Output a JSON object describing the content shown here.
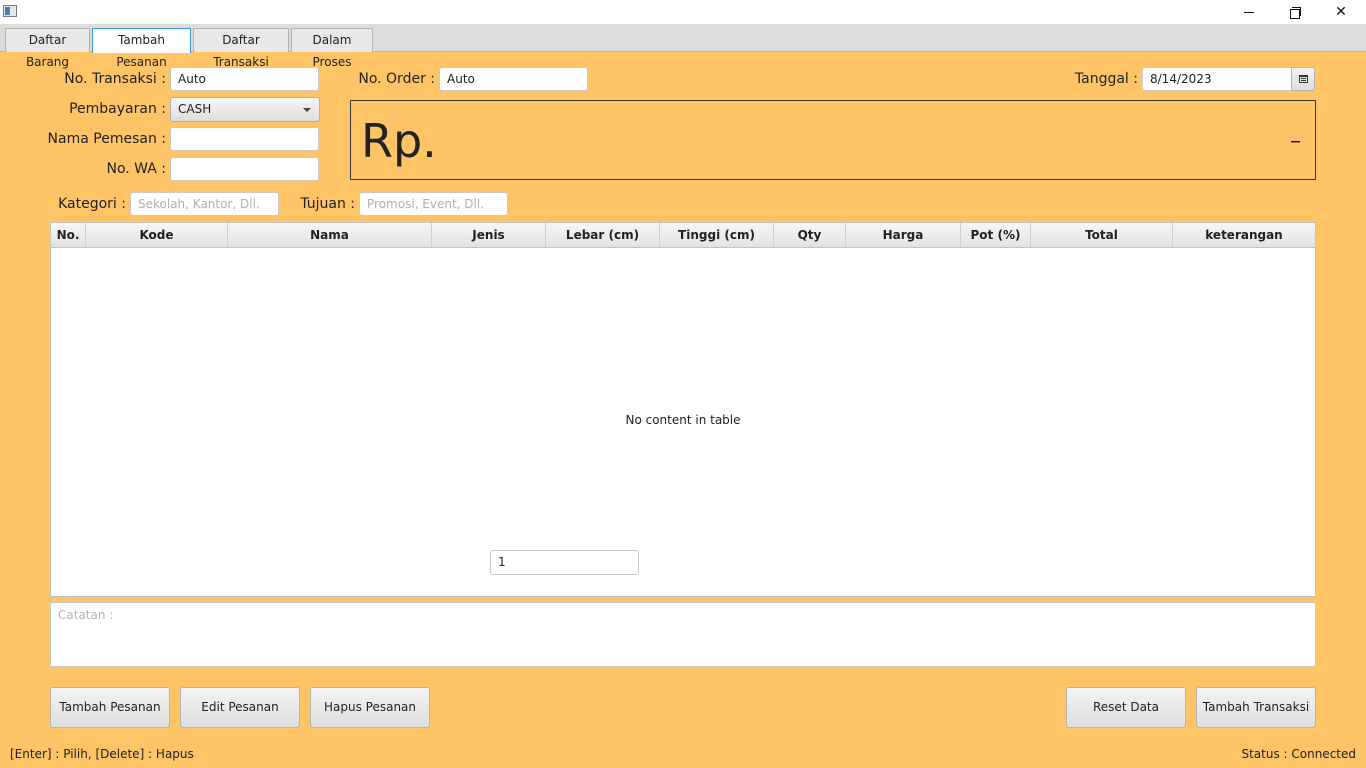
{
  "window": {
    "icon": "app-window-icon",
    "controls": {
      "minimize": "minimize-icon",
      "maximize": "restore-icon",
      "close": "close-icon"
    }
  },
  "tabs": [
    {
      "label": "Daftar Barang",
      "active": false
    },
    {
      "label": "Tambah Pesanan",
      "active": true
    },
    {
      "label": "Daftar Transaksi",
      "active": false
    },
    {
      "label": "Dalam Proses",
      "active": false
    }
  ],
  "form": {
    "no_transaksi_label": "No. Transaksi :",
    "no_transaksi_value": "Auto",
    "pembayaran_label": "Pembayaran :",
    "pembayaran_value": "CASH",
    "nama_pemesan_label": "Nama Pemesan :",
    "nama_pemesan_value": "",
    "no_wa_label": "No. WA :",
    "no_wa_value": "",
    "no_order_label": "No. Order :",
    "no_order_value": "Auto",
    "tanggal_label": "Tanggal :",
    "tanggal_value": "8/14/2023",
    "kategori_label": "Kategori :",
    "kategori_placeholder": "Sekolah, Kantor, Dll.",
    "tujuan_label": "Tujuan :",
    "tujuan_placeholder": "Promosi, Event, Dll."
  },
  "total": {
    "currency": "Rp.",
    "value": "–"
  },
  "table": {
    "columns": [
      "No.",
      "Kode",
      "Nama",
      "Jenis",
      "Lebar (cm)",
      "Tinggi (cm)",
      "Qty",
      "Harga",
      "Pot (%)",
      "Total",
      "keterangan"
    ],
    "rows": [],
    "empty_message": "No content in table",
    "qty_input_value": "1"
  },
  "notes": {
    "placeholder": "Catatan :"
  },
  "buttons": {
    "tambah_pesanan": "Tambah Pesanan",
    "edit_pesanan": "Edit Pesanan",
    "hapus_pesanan": "Hapus Pesanan",
    "reset_data": "Reset Data",
    "tambah_transaksi": "Tambah Transaksi"
  },
  "status": {
    "hint": "[Enter] : Pilih, [Delete] : Hapus",
    "connection": "Status : Connected"
  },
  "colors": {
    "background": "#fec466",
    "tab_active_border": "#3c9ad7"
  }
}
